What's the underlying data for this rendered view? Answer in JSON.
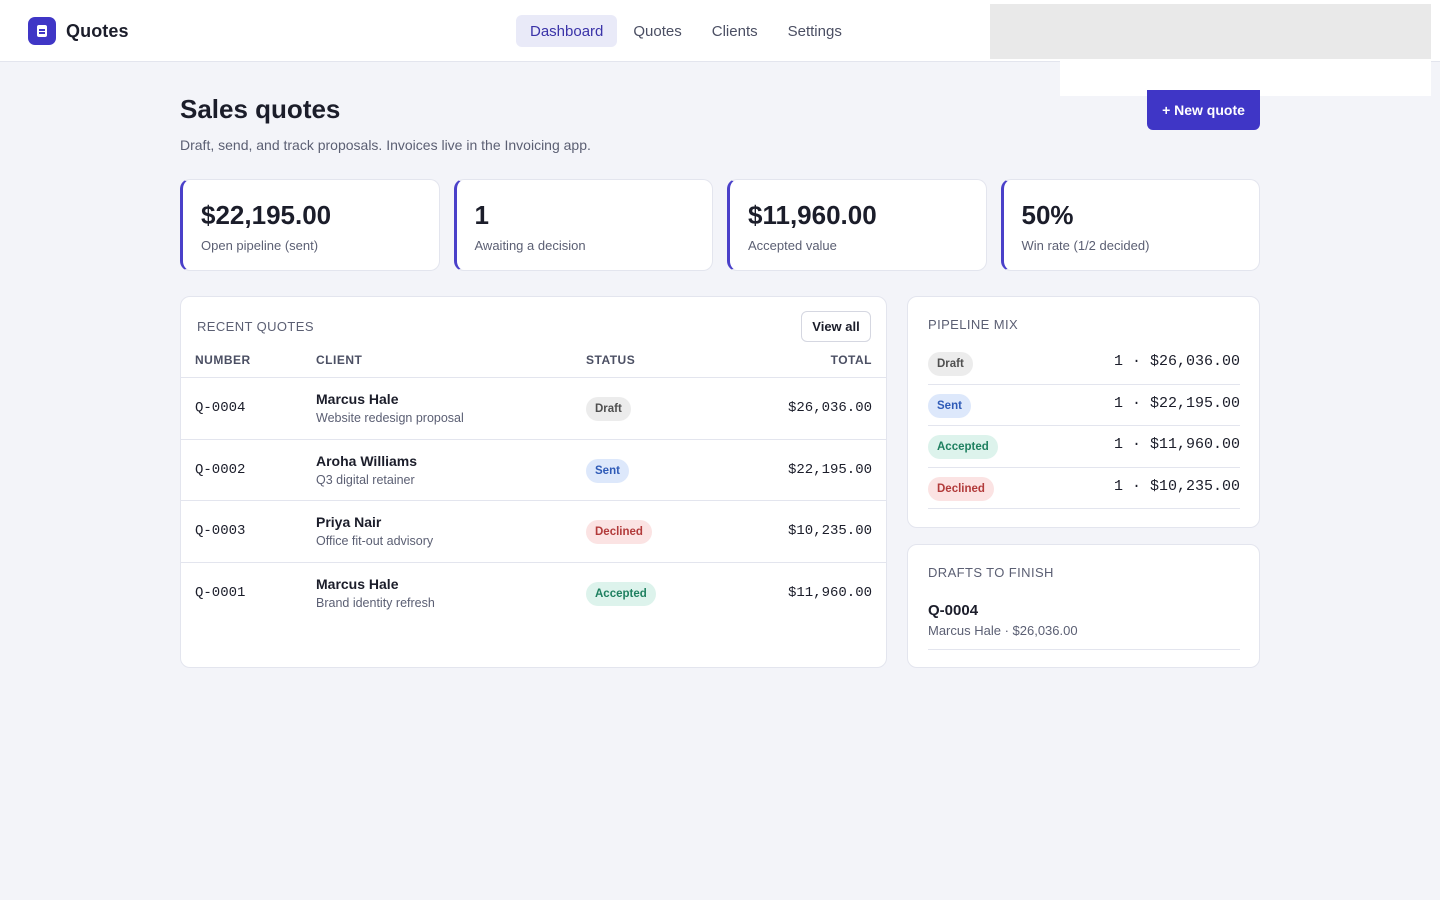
{
  "app": {
    "name": "Quotes",
    "logo_icon": "document-icon",
    "accent": "#3f36c6"
  },
  "nav": [
    {
      "label": "Dashboard",
      "active": true
    },
    {
      "label": "Quotes",
      "active": false
    },
    {
      "label": "Clients",
      "active": false
    },
    {
      "label": "Settings",
      "active": false
    }
  ],
  "header": {
    "title": "Sales quotes",
    "subtitle": "Draft, send, and track proposals. Invoices live in the Invoicing app.",
    "new_quote_label": "+ New quote"
  },
  "kpis": [
    {
      "value": "$22,195.00",
      "label": "Open pipeline (sent)"
    },
    {
      "value": "1",
      "label": "Awaiting a decision"
    },
    {
      "value": "$11,960.00",
      "label": "Accepted value"
    },
    {
      "value": "50%",
      "label": "Win rate (1/2 decided)"
    }
  ],
  "recent": {
    "heading": "RECENT QUOTES",
    "view_all_label": "View all",
    "columns": {
      "number": "NUMBER",
      "client": "CLIENT",
      "status": "STATUS",
      "total": "TOTAL"
    },
    "rows": [
      {
        "number": "Q-0004",
        "client": "Marcus Hale",
        "description": "Website redesign proposal",
        "status": "Draft",
        "total": "$26,036.00"
      },
      {
        "number": "Q-0002",
        "client": "Aroha Williams",
        "description": "Q3 digital retainer",
        "status": "Sent",
        "total": "$22,195.00"
      },
      {
        "number": "Q-0003",
        "client": "Priya Nair",
        "description": "Office fit-out advisory",
        "status": "Declined",
        "total": "$10,235.00"
      },
      {
        "number": "Q-0001",
        "client": "Marcus Hale",
        "description": "Brand identity refresh",
        "status": "Accepted",
        "total": "$11,960.00"
      }
    ]
  },
  "pipeline": {
    "heading": "PIPELINE MIX",
    "items": [
      {
        "status": "Draft",
        "value": "1 · $26,036.00"
      },
      {
        "status": "Sent",
        "value": "1 · $22,195.00"
      },
      {
        "status": "Accepted",
        "value": "1 · $11,960.00"
      },
      {
        "status": "Declined",
        "value": "1 · $10,235.00"
      }
    ]
  },
  "drafts": {
    "heading": "DRAFTS TO FINISH",
    "items": [
      {
        "number": "Q-0004",
        "meta": "Marcus Hale · $26,036.00"
      }
    ]
  },
  "status_colors": {
    "Draft": "#ececec",
    "Sent": "#dde8fb",
    "Declined": "#fbe3e3",
    "Accepted": "#ddf3ec"
  }
}
